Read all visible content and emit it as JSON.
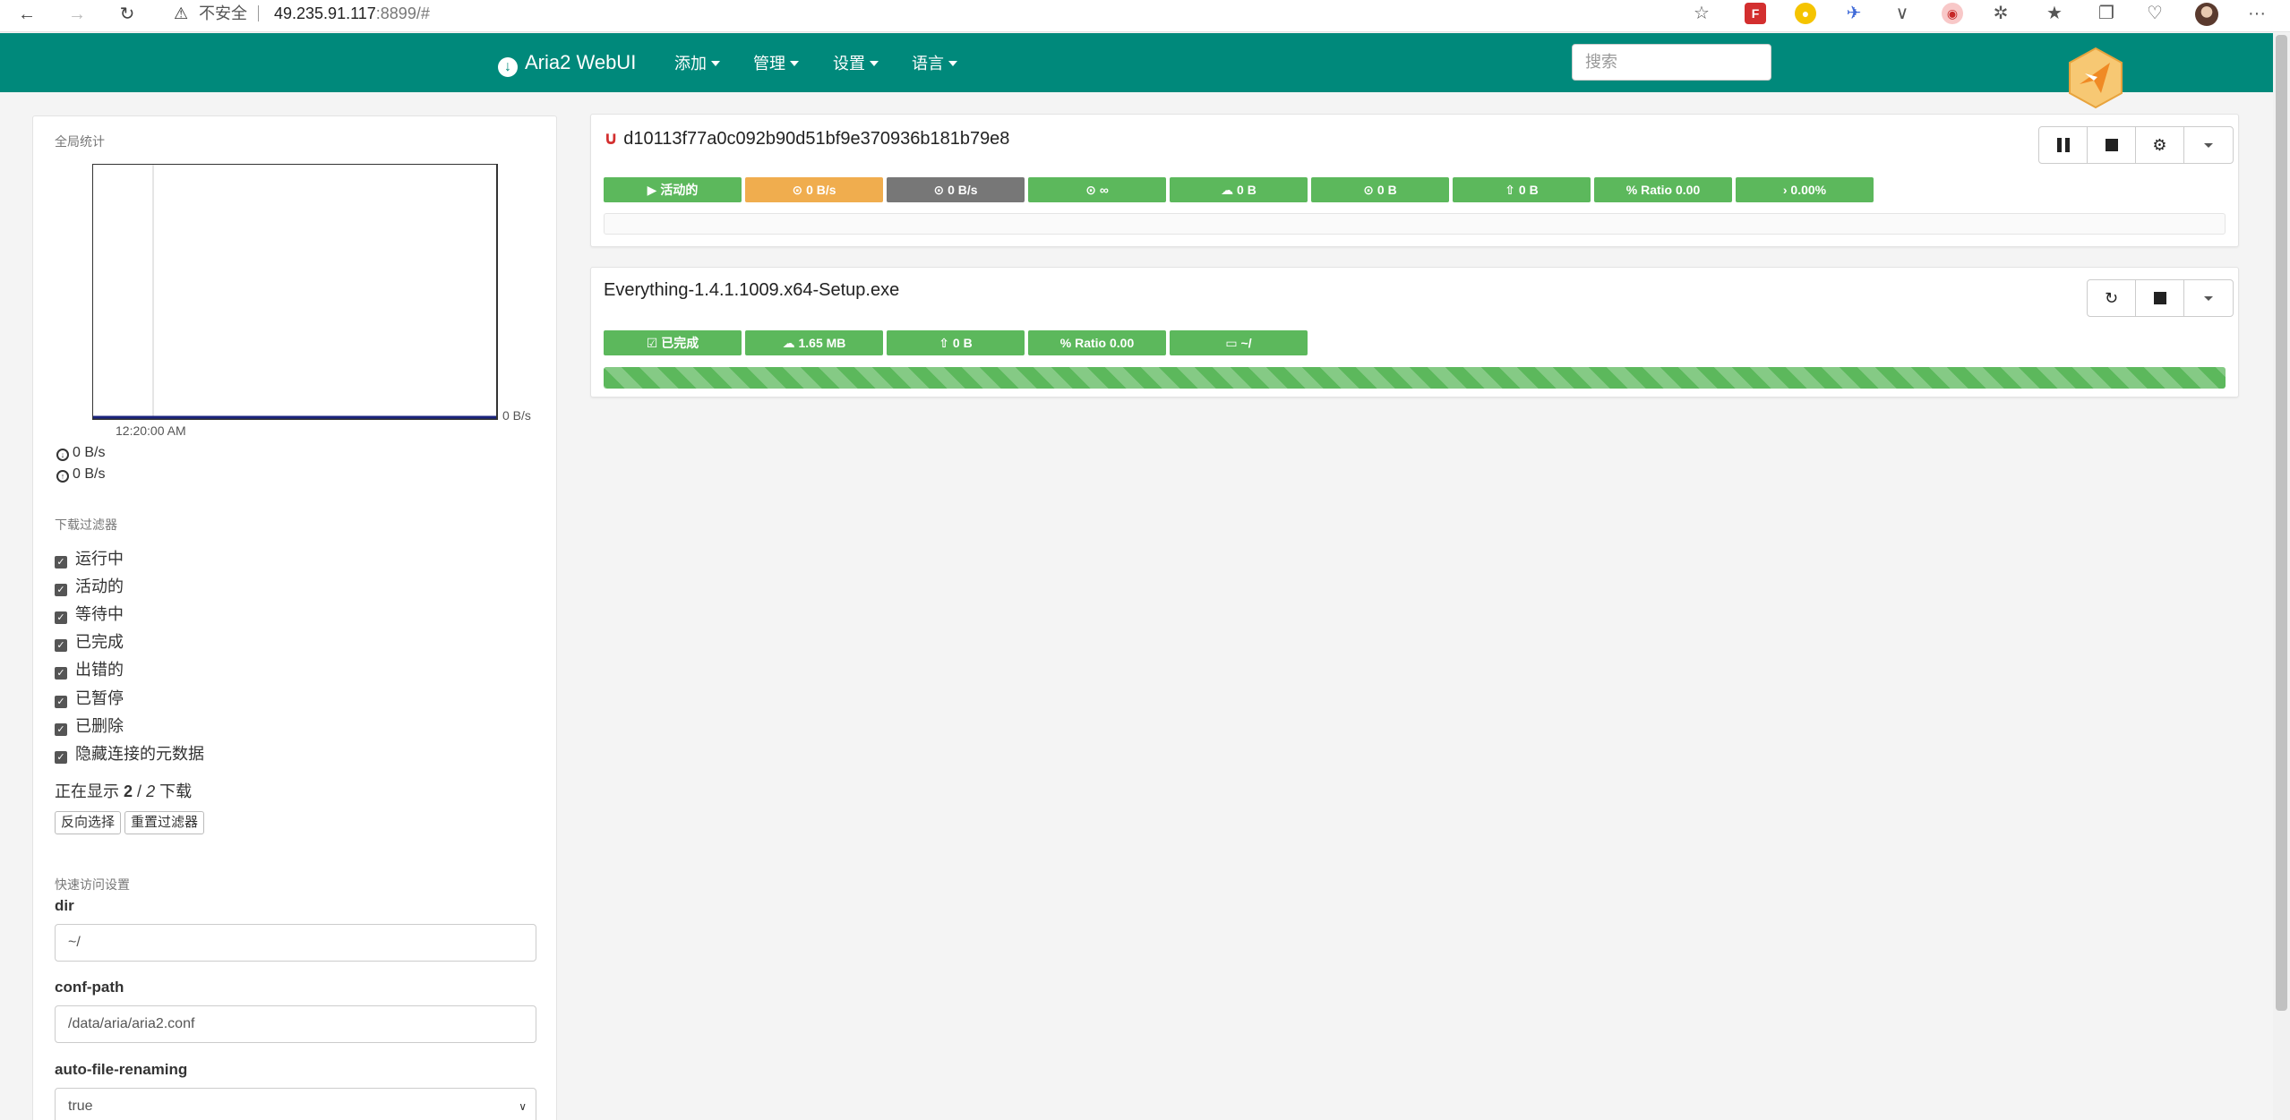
{
  "browser": {
    "back": "←",
    "forward": "→",
    "reload": "↻",
    "warning": "⚠",
    "insecure": "不安全",
    "url_host": "49.235.91.117",
    "url_rest": ":8899/#",
    "menu": "···"
  },
  "navbar": {
    "brand": "Aria2 WebUI",
    "menus": [
      "添加",
      "管理",
      "设置",
      "语言"
    ],
    "search_placeholder": "搜索"
  },
  "sidebar": {
    "stats_title": "全局统计",
    "chart_time": "12:20:00 AM",
    "chart_speed_label": "0 B/s",
    "download_speed": "0 B/s",
    "upload_speed": "0 B/s",
    "filter_title": "下载过滤器",
    "filters": [
      "运行中",
      "活动的",
      "等待中",
      "已完成",
      "出错的",
      "已暂停",
      "已删除",
      "隐藏连接的元数据"
    ],
    "showing_prefix": "正在显示",
    "showing_count": "2",
    "showing_sep": "/",
    "showing_total": "2",
    "showing_suffix": "下载",
    "invert_button": "反向选择",
    "reset_button": "重置过滤器",
    "quick_title": "快速访问设置",
    "fields": [
      {
        "label": "dir",
        "value": "~/"
      },
      {
        "label": "conf-path",
        "value": "/data/aria/aria2.conf"
      },
      {
        "label": "auto-file-renaming",
        "value": "true"
      }
    ]
  },
  "downloads": [
    {
      "name": "d10113f77a0c092b90d51bf9e370936b181b79e8",
      "badges": [
        "活动的",
        "0 B/s",
        "0 B/s",
        "∞",
        "0 B",
        "0 B",
        "0 B",
        "Ratio 0.00",
        "0.00%"
      ],
      "badge_colors": [
        "#5cb85c",
        "#f0ad4e",
        "#777777",
        "#5cb85c",
        "#5cb85c",
        "#5cb85c",
        "#5cb85c",
        "#5cb85c",
        "#5cb85c"
      ],
      "badge_icons": [
        "▶",
        "⊙",
        "⊙",
        "⊙",
        "☁",
        "⊙",
        "⇧",
        "%",
        "›"
      ],
      "progress": 0
    },
    {
      "name": "Everything-1.4.1.1009.x64-Setup.exe",
      "badges": [
        "已完成",
        "1.65 MB",
        "0 B",
        "Ratio 0.00",
        "~/"
      ],
      "badge_colors": [
        "#5cb85c",
        "#5cb85c",
        "#5cb85c",
        "#5cb85c",
        "#5cb85c"
      ],
      "badge_icons": [
        "☑",
        "☁",
        "⇧",
        "%",
        "▭"
      ],
      "progress": 100
    }
  ],
  "colors": {
    "navbar": "#00897b",
    "success": "#5cb85c",
    "warning": "#f0ad4e",
    "default": "#777777"
  }
}
